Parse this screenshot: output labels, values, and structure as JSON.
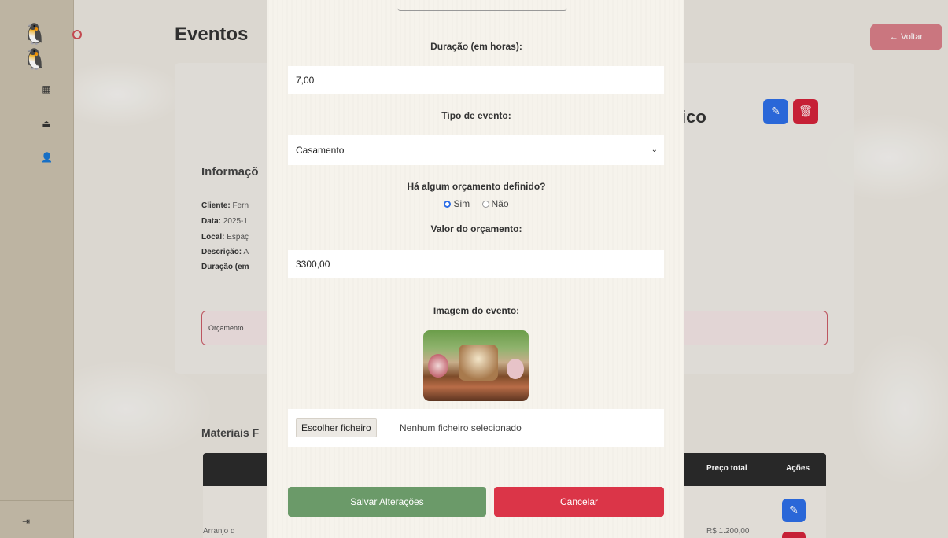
{
  "background": {
    "page_title": "Eventos",
    "back_button_label": "← Voltar",
    "event_title_tail": "ico",
    "info_heading": "Informaçõ",
    "info_lines": [
      {
        "label": "Cliente:",
        "value": "Fern"
      },
      {
        "label": "Data:",
        "value": "2025-1"
      },
      {
        "label": "Local:",
        "value": "Espaç"
      },
      {
        "label": "Descrição:",
        "value": "A"
      },
      {
        "label": "Duração (em",
        "value": ""
      }
    ],
    "budget_label": "Orçamento",
    "materials_heading": "Materiais F",
    "table": {
      "headers": [
        "Preço total",
        "Ações"
      ],
      "rows": [
        {
          "name": "Arranjo d",
          "price": "R$ 1.200,00"
        }
      ]
    }
  },
  "sidebar": {
    "logo": "🐧🐧",
    "icons": [
      "calendar-icon",
      "briefcase-icon",
      "user-icon"
    ],
    "logout_icon": "logout-icon"
  },
  "modal": {
    "duration_label": "Duração (em horas):",
    "duration_value": "7,00",
    "event_type_label": "Tipo de evento:",
    "event_type_value": "Casamento",
    "budget_question": "Há algum orçamento definido?",
    "budget_options": [
      "Sim",
      "Não"
    ],
    "budget_selected": "Sim",
    "budget_value_label": "Valor do orçamento:",
    "budget_value": "3300,00",
    "image_label": "Imagem do evento:",
    "file_button": "Escolher ficheiro",
    "file_status": "Nenhum ficheiro selecionado",
    "save_button": "Salvar Alterações",
    "cancel_button": "Cancelar"
  },
  "colors": {
    "accent_blue": "#2d6ee6",
    "danger_red": "#d3233a",
    "save_green": "#6b9a69",
    "cancel_red": "#db3548",
    "back_pink": "#d77e87"
  }
}
